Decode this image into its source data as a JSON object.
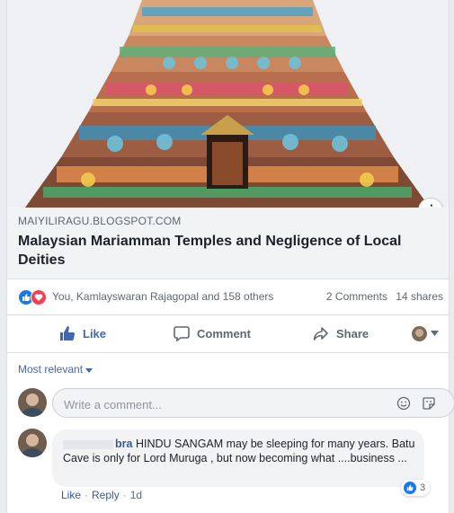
{
  "post": {
    "link": {
      "domain": "MAIYILIRAGU.BLOGSPOT.COM",
      "title": "Malaysian Mariamman Temples and Negligence of Local Deities",
      "info_icon": "info-icon",
      "info_label": "i"
    },
    "reactions": {
      "types": [
        "like",
        "love"
      ],
      "summary": "You, Kamlayswaran Rajagopal and 158 others",
      "comments": "2 Comments",
      "shares": "14 shares"
    },
    "actions": {
      "like": "Like",
      "comment": "Comment",
      "share": "Share"
    }
  },
  "comments": {
    "sort_label": "Most relevant",
    "input_placeholder": "Write a comment...",
    "items": [
      {
        "author": "bra",
        "text": "HINDU SANGAM may be sleeping for many years. Batu Cave is only for Lord Muruga , but now becoming what ....business ...",
        "like_count": "3",
        "like_label": "Like",
        "reply_label": "Reply",
        "separator": "·",
        "time": "1d"
      }
    ]
  },
  "colors": {
    "brand_blue": "#4267b2",
    "like_blue": "#1877f2",
    "love_red": "#f33e58",
    "link_bg": "#f2f3f5"
  }
}
